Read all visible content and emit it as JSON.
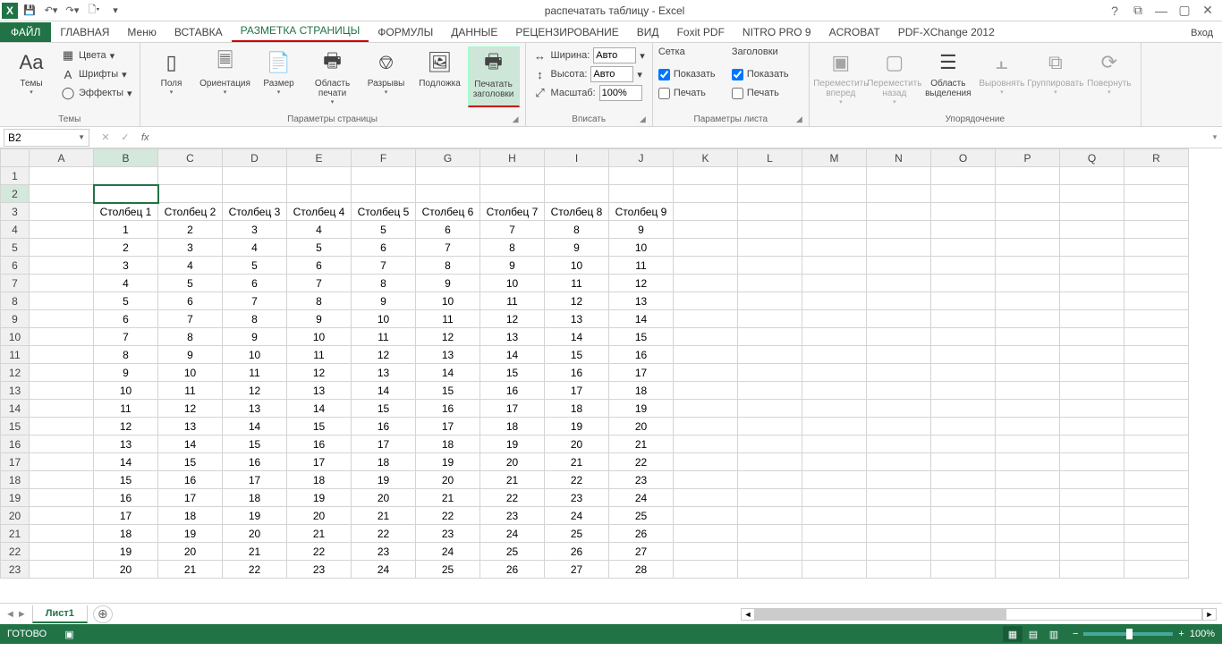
{
  "titlebar": {
    "title": "распечатать таблицу - Excel"
  },
  "tabs": {
    "file": "ФАЙЛ",
    "list": [
      "ГЛАВНАЯ",
      "Меню",
      "ВСТАВКА",
      "РАЗМЕТКА СТРАНИЦЫ",
      "ФОРМУЛЫ",
      "ДАННЫЕ",
      "РЕЦЕНЗИРОВАНИЕ",
      "ВИД",
      "Foxit PDF",
      "NITRO PRO 9",
      "ACROBAT",
      "PDF-XChange 2012"
    ],
    "active": 3,
    "signin": "Вход"
  },
  "ribbon": {
    "themes": {
      "label": "Темы",
      "btn": "Темы",
      "colors": "Цвета",
      "fonts": "Шрифты",
      "effects": "Эффекты"
    },
    "page_setup": {
      "label": "Параметры страницы",
      "margins": "Поля",
      "orientation": "Ориентация",
      "size": "Размер",
      "print_area": "Область печати",
      "breaks": "Разрывы",
      "background": "Подложка",
      "print_titles": "Печатать заголовки"
    },
    "scale": {
      "label": "Вписать",
      "width": "Ширина:",
      "height": "Высота:",
      "scale": "Масштаб:",
      "auto": "Авто",
      "pct": "100%"
    },
    "sheet_opts": {
      "label": "Параметры листа",
      "grid": "Сетка",
      "headings": "Заголовки",
      "show": "Показать",
      "print": "Печать"
    },
    "arrange": {
      "label": "Упорядочение",
      "forward": "Переместить вперед",
      "backward": "Переместить назад",
      "selection": "Область выделения",
      "align": "Выровнять",
      "group": "Группировать",
      "rotate": "Повернуть"
    }
  },
  "fbar": {
    "cell": "B2",
    "fx": "fx",
    "formula": ""
  },
  "grid": {
    "cols": [
      "A",
      "B",
      "C",
      "D",
      "E",
      "F",
      "G",
      "H",
      "I",
      "J",
      "K",
      "L",
      "M",
      "N",
      "O",
      "P",
      "Q",
      "R"
    ],
    "active_col": 1,
    "active_row": 1,
    "pagebreak_after_col": 8,
    "pagebreak_far_col": 15,
    "rows": [
      [
        "",
        "",
        "",
        "",
        "",
        "",
        "",
        "",
        "",
        "",
        "",
        "",
        "",
        "",
        "",
        "",
        "",
        ""
      ],
      [
        "",
        "",
        "",
        "",
        "",
        "",
        "",
        "",
        "",
        "",
        "",
        "",
        "",
        "",
        "",
        "",
        "",
        ""
      ],
      [
        "",
        "Столбец 1",
        "Столбец 2",
        "Столбец 3",
        "Столбец 4",
        "Столбец 5",
        "Столбец 6",
        "Столбец 7",
        "Столбец 8",
        "Столбец 9",
        "",
        "",
        "",
        "",
        "",
        "",
        "",
        ""
      ],
      [
        "",
        "1",
        "2",
        "3",
        "4",
        "5",
        "6",
        "7",
        "8",
        "9",
        "",
        "",
        "",
        "",
        "",
        "",
        "",
        ""
      ],
      [
        "",
        "2",
        "3",
        "4",
        "5",
        "6",
        "7",
        "8",
        "9",
        "10",
        "",
        "",
        "",
        "",
        "",
        "",
        "",
        ""
      ],
      [
        "",
        "3",
        "4",
        "5",
        "6",
        "7",
        "8",
        "9",
        "10",
        "11",
        "",
        "",
        "",
        "",
        "",
        "",
        "",
        ""
      ],
      [
        "",
        "4",
        "5",
        "6",
        "7",
        "8",
        "9",
        "10",
        "11",
        "12",
        "",
        "",
        "",
        "",
        "",
        "",
        "",
        ""
      ],
      [
        "",
        "5",
        "6",
        "7",
        "8",
        "9",
        "10",
        "11",
        "12",
        "13",
        "",
        "",
        "",
        "",
        "",
        "",
        "",
        ""
      ],
      [
        "",
        "6",
        "7",
        "8",
        "9",
        "10",
        "11",
        "12",
        "13",
        "14",
        "",
        "",
        "",
        "",
        "",
        "",
        "",
        ""
      ],
      [
        "",
        "7",
        "8",
        "9",
        "10",
        "11",
        "12",
        "13",
        "14",
        "15",
        "",
        "",
        "",
        "",
        "",
        "",
        "",
        ""
      ],
      [
        "",
        "8",
        "9",
        "10",
        "11",
        "12",
        "13",
        "14",
        "15",
        "16",
        "",
        "",
        "",
        "",
        "",
        "",
        "",
        ""
      ],
      [
        "",
        "9",
        "10",
        "11",
        "12",
        "13",
        "14",
        "15",
        "16",
        "17",
        "",
        "",
        "",
        "",
        "",
        "",
        "",
        ""
      ],
      [
        "",
        "10",
        "11",
        "12",
        "13",
        "14",
        "15",
        "16",
        "17",
        "18",
        "",
        "",
        "",
        "",
        "",
        "",
        "",
        ""
      ],
      [
        "",
        "11",
        "12",
        "13",
        "14",
        "15",
        "16",
        "17",
        "18",
        "19",
        "",
        "",
        "",
        "",
        "",
        "",
        "",
        ""
      ],
      [
        "",
        "12",
        "13",
        "14",
        "15",
        "16",
        "17",
        "18",
        "19",
        "20",
        "",
        "",
        "",
        "",
        "",
        "",
        "",
        ""
      ],
      [
        "",
        "13",
        "14",
        "15",
        "16",
        "17",
        "18",
        "19",
        "20",
        "21",
        "",
        "",
        "",
        "",
        "",
        "",
        "",
        ""
      ],
      [
        "",
        "14",
        "15",
        "16",
        "17",
        "18",
        "19",
        "20",
        "21",
        "22",
        "",
        "",
        "",
        "",
        "",
        "",
        "",
        ""
      ],
      [
        "",
        "15",
        "16",
        "17",
        "18",
        "19",
        "20",
        "21",
        "22",
        "23",
        "",
        "",
        "",
        "",
        "",
        "",
        "",
        ""
      ],
      [
        "",
        "16",
        "17",
        "18",
        "19",
        "20",
        "21",
        "22",
        "23",
        "24",
        "",
        "",
        "",
        "",
        "",
        "",
        "",
        ""
      ],
      [
        "",
        "17",
        "18",
        "19",
        "20",
        "21",
        "22",
        "23",
        "24",
        "25",
        "",
        "",
        "",
        "",
        "",
        "",
        "",
        ""
      ],
      [
        "",
        "18",
        "19",
        "20",
        "21",
        "22",
        "23",
        "24",
        "25",
        "26",
        "",
        "",
        "",
        "",
        "",
        "",
        "",
        ""
      ],
      [
        "",
        "19",
        "20",
        "21",
        "22",
        "23",
        "24",
        "25",
        "26",
        "27",
        "",
        "",
        "",
        "",
        "",
        "",
        "",
        ""
      ],
      [
        "",
        "20",
        "21",
        "22",
        "23",
        "24",
        "25",
        "26",
        "27",
        "28",
        "",
        "",
        "",
        "",
        "",
        "",
        "",
        ""
      ]
    ]
  },
  "sheets": {
    "active": "Лист1"
  },
  "status": {
    "ready": "ГОТОВО",
    "zoom": "100%"
  }
}
